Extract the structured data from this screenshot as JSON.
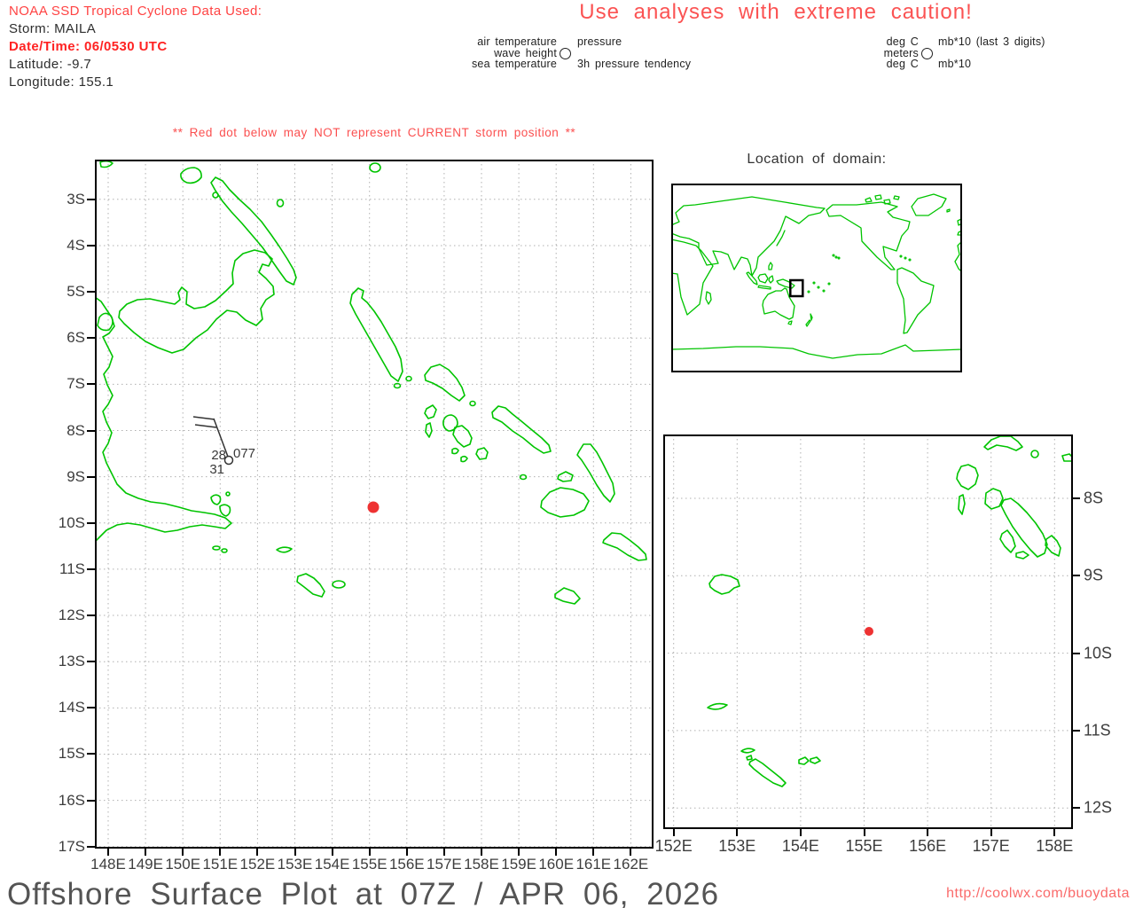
{
  "colors": {
    "coastline_green": "#00c400",
    "storm_red": "#ee3232",
    "caution_red": "#fb5050",
    "header_red": "#ff4343",
    "axis_gray": "#3d3d3d",
    "title_gray": "#545454",
    "url_red": "#fa6a6a"
  },
  "header": {
    "noaa_line": "NOAA SSD Tropical Cyclone Data Used:",
    "storm_line": "Storm: MAILA",
    "datetime_line": "Date/Time: 06/0530 UTC",
    "latitude_line": "Latitude: -9.7",
    "longitude_line": "Longitude: 155.1",
    "caution_title": "Use analyses with extreme caution!"
  },
  "station_model_legend": {
    "variables": {
      "top_left": "air temperature",
      "mid_left": "wave height",
      "bottom_left": "sea temperature",
      "top_right": "pressure",
      "mid_right": "",
      "bottom_right": "3h pressure tendency"
    },
    "units": {
      "top_left": "deg C",
      "mid_left": "meters",
      "bottom_left": "deg C",
      "top_right": "mb*10 (last 3 digits)",
      "mid_right": "",
      "bottom_right": "mb*10"
    }
  },
  "warning": "** Red dot below may NOT represent CURRENT storm position **",
  "main_map": {
    "x_ticks": [
      "148E",
      "149E",
      "150E",
      "151E",
      "152E",
      "153E",
      "154E",
      "155E",
      "156E",
      "157E",
      "158E",
      "159E",
      "160E",
      "161E",
      "162E"
    ],
    "y_ticks": [
      "3S",
      "4S",
      "5S",
      "6S",
      "7S",
      "8S",
      "9S",
      "10S",
      "11S",
      "12S",
      "13S",
      "14S",
      "15S",
      "16S",
      "17S"
    ],
    "station": {
      "air_temp": "28",
      "pressure": "077",
      "sea_temp": "31"
    },
    "storm_dot": {
      "longitude": 155.1,
      "latitude": -9.7
    }
  },
  "inset": {
    "title": "Location of domain:"
  },
  "right_map": {
    "x_ticks": [
      "152E",
      "153E",
      "154E",
      "155E",
      "156E",
      "157E",
      "158E"
    ],
    "y_ticks": [
      "8S",
      "9S",
      "10S",
      "11S",
      "12S"
    ],
    "storm_dot": {
      "longitude": 155.1,
      "latitude": -9.7
    }
  },
  "footer": {
    "title": "Offshore Surface Plot at 07Z / APR 06, 2026",
    "url": "http://coolwx.com/buoydata"
  }
}
